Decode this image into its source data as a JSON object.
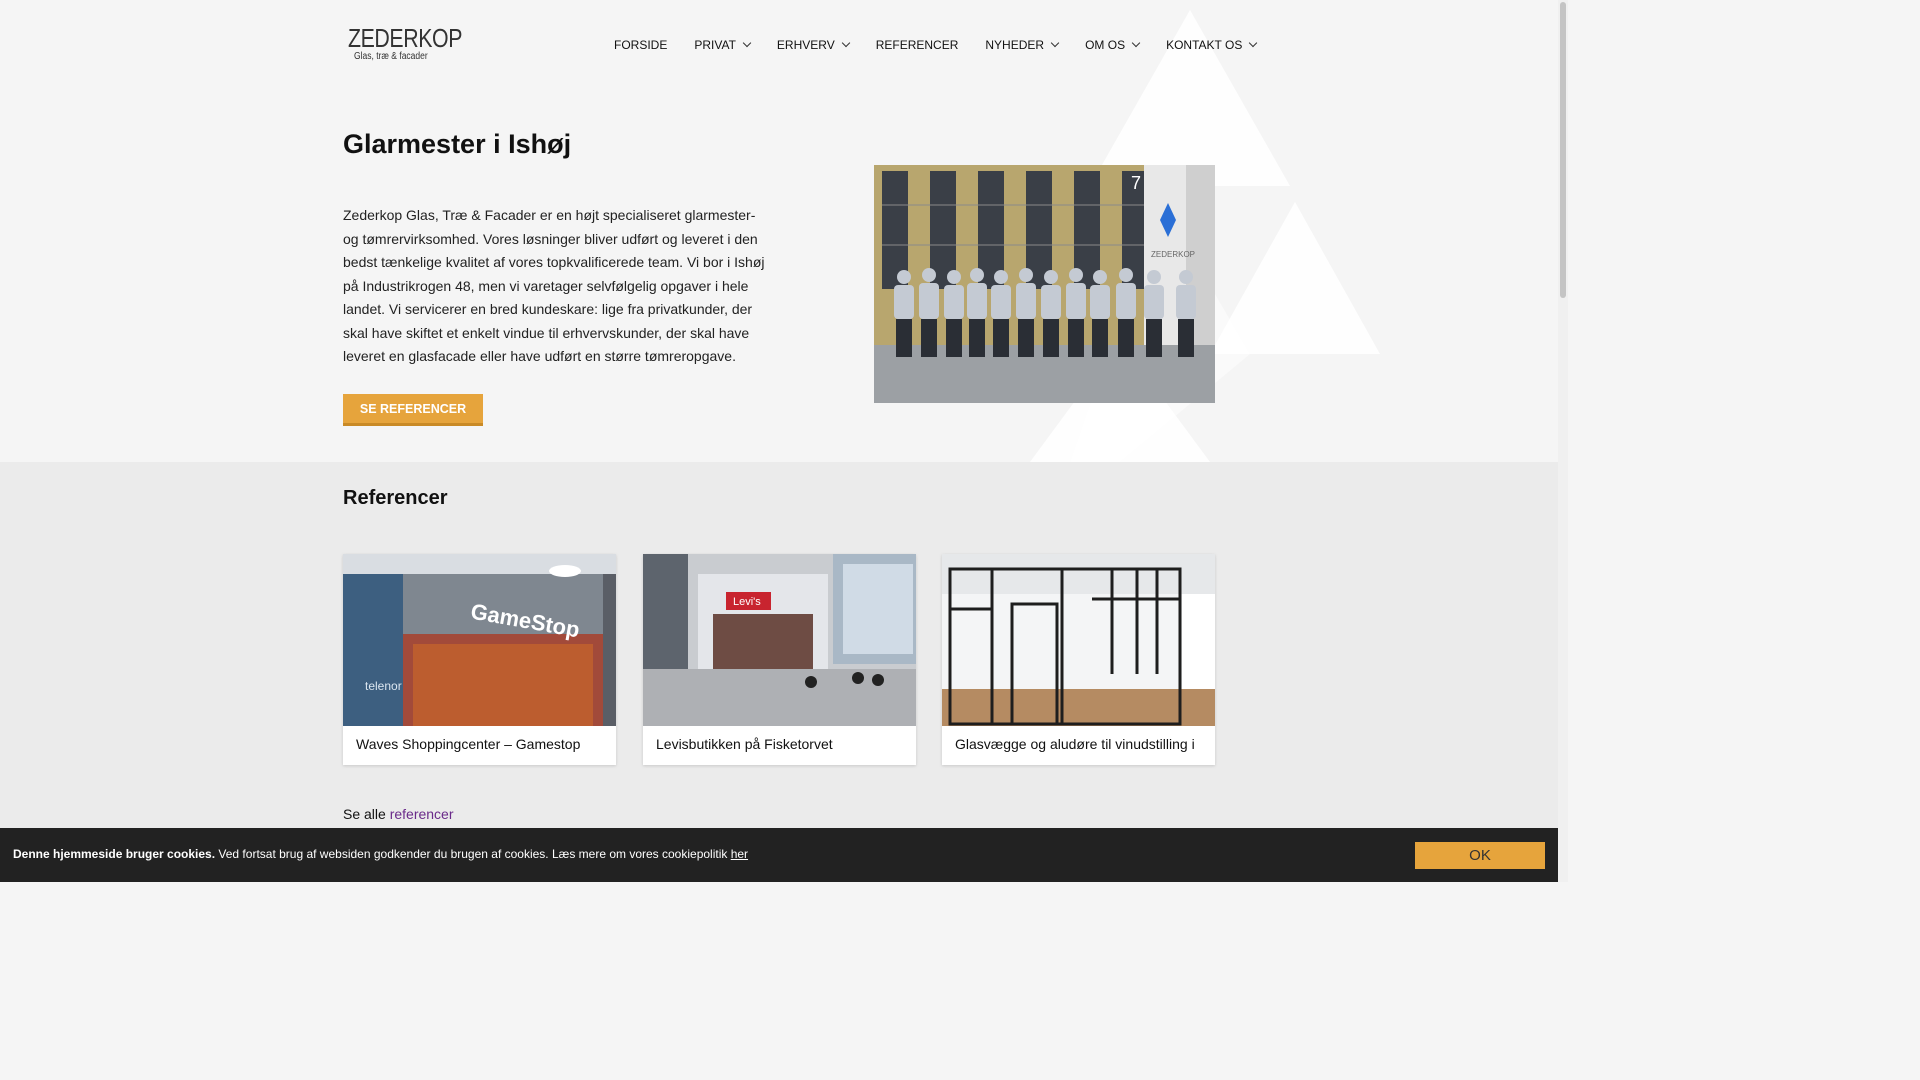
{
  "brand": {
    "name": "ZEDERKOP",
    "tagline": "Glas, træ & facader",
    "logo_color": "#2a6fd6"
  },
  "nav": {
    "items": [
      {
        "label": "FORSIDE",
        "dropdown": false
      },
      {
        "label": "PRIVAT",
        "dropdown": true
      },
      {
        "label": "ERHVERV",
        "dropdown": true
      },
      {
        "label": "REFERENCER",
        "dropdown": false
      },
      {
        "label": "NYHEDER",
        "dropdown": true
      },
      {
        "label": "OM OS",
        "dropdown": true
      },
      {
        "label": "KONTAKT OS",
        "dropdown": true
      }
    ]
  },
  "hero": {
    "title": "Glarmester i Ishøj",
    "body": "Zederkop Glas, Træ & Facader er en højt specialiseret glarmester- og tømrervirksomhed. Vores løsninger bliver udført og leveret i den bedst tænkelige kvalitet af vores topkvalificerede team. Vi bor i Ishøj på Industrikrogen 48, men vi varetager selvfølgelig opgaver i hele landet. Vi servicerer en bred kundeskare: lige fra privatkunder, der skal have skiftet et enkelt vindue til erhvervskunder, der skal have leveret en glasfacade eller have udført en større tømreropgave.",
    "button_label": "SE REFERENCER",
    "accent_color": "#e6a43c",
    "photo_building_number": "7",
    "photo_sign_text": "ZEDERKOP"
  },
  "references": {
    "title": "Referencer",
    "cards": [
      {
        "title": "Waves Shoppingcenter – Gamestop",
        "image_sign": "GameStop",
        "image_sign2": "telenor"
      },
      {
        "title": "Levisbutikken på Fisketorvet",
        "image_sign": "Levi's"
      },
      {
        "title": "Glasvægge og aludøre til vinudstilling i"
      }
    ],
    "see_all_prefix": "Se alle",
    "see_all_link": "referencer"
  },
  "cookie": {
    "bold": "Denne hjemmeside bruger cookies.",
    "text": " Ved fortsat brug af websiden godkender du brugen af cookies. Læs mere om vores cookiepolitik ",
    "link": "her",
    "ok_label": "OK"
  }
}
